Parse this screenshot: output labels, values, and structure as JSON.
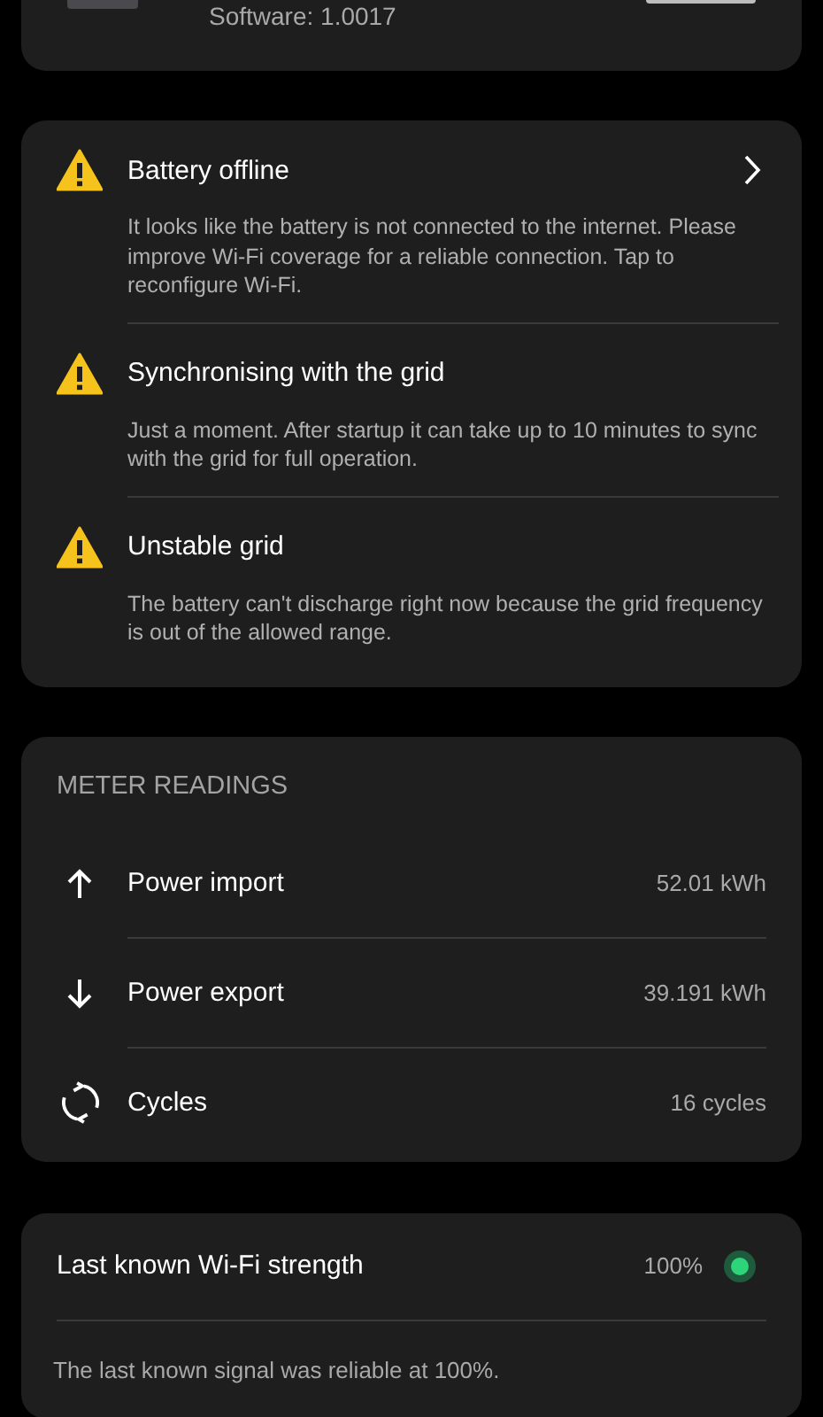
{
  "device": {
    "software": "Software: 1.0017"
  },
  "alerts": [
    {
      "title": "Battery offline",
      "chevron": true,
      "description": "It looks like the battery is not connected to the internet. Please improve Wi-Fi coverage for a reliable connection. Tap to reconfigure Wi-Fi."
    },
    {
      "title": "Synchronising with the grid",
      "chevron": false,
      "description": "Just a moment. After startup it can take up to 10 minutes to sync with the grid for full operation."
    },
    {
      "title": "Unstable grid",
      "chevron": false,
      "description": "The battery can't discharge right now because the grid frequency is out of the allowed range."
    }
  ],
  "meter_readings": {
    "heading": "METER READINGS",
    "rows": [
      {
        "kind": "import",
        "label": "Power import",
        "value": "52.01 kWh"
      },
      {
        "kind": "export",
        "label": "Power export",
        "value": "39.191 kWh"
      },
      {
        "kind": "cycles",
        "label": "Cycles",
        "value": "16 cycles"
      }
    ]
  },
  "wifi": {
    "title": "Last known Wi-Fi strength",
    "value": "100%",
    "color": "#2ed47a",
    "description": "The last known signal was reliable at 100%."
  }
}
